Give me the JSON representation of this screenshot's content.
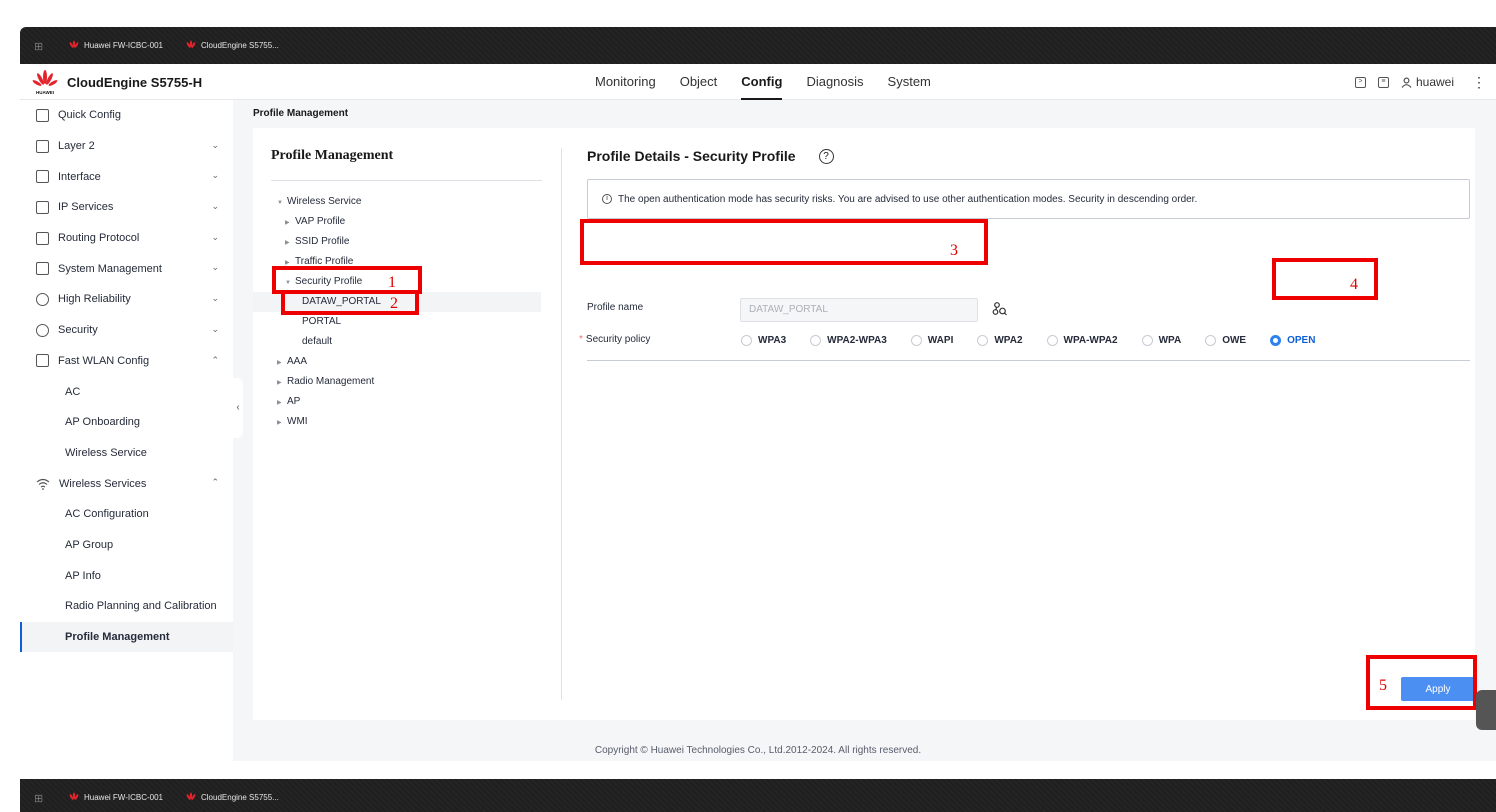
{
  "browser": {
    "tabs": [
      "Huawei FW-ICBC-001",
      "CloudEngine S5755..."
    ]
  },
  "header": {
    "logo_text": "HUAWEI",
    "product": "CloudEngine S5755-H",
    "nav": [
      "Monitoring",
      "Object",
      "Config",
      "Diagnosis",
      "System"
    ],
    "active_nav": "Config",
    "user": "huawei",
    "more": "⋮"
  },
  "sidebar": {
    "items": [
      {
        "label": "Quick Config",
        "icon": "quick-config-icon"
      },
      {
        "label": "Layer 2",
        "icon": "layer2-icon",
        "chevron": "⌄"
      },
      {
        "label": "Interface",
        "icon": "interface-icon",
        "chevron": "⌄"
      },
      {
        "label": "IP Services",
        "icon": "ip-services-icon",
        "chevron": "⌄"
      },
      {
        "label": "Routing Protocol",
        "icon": "routing-icon",
        "chevron": "⌄"
      },
      {
        "label": "System Management",
        "icon": "system-management-icon",
        "chevron": "⌄"
      },
      {
        "label": "High Reliability",
        "icon": "reliability-icon",
        "chevron": "⌄"
      },
      {
        "label": "Security",
        "icon": "security-icon",
        "chevron": "⌄"
      },
      {
        "label": "Fast WLAN Config",
        "icon": "wlan-config-icon",
        "chevron": "⌃"
      },
      {
        "label": "AC"
      },
      {
        "label": "AP Onboarding"
      },
      {
        "label": "Wireless Service"
      },
      {
        "label": "Wireless Services",
        "icon": "wifi-icon",
        "chevron": "⌃"
      },
      {
        "label": "AC Configuration"
      },
      {
        "label": "AP Group"
      },
      {
        "label": "AP Info"
      },
      {
        "label": "Radio Planning and Calibration"
      },
      {
        "label": "Profile Management"
      }
    ],
    "collapse_glyph": "‹"
  },
  "breadcrumb": "Profile Management",
  "tree": {
    "title": "Profile Management",
    "nodes": [
      {
        "label": "Wireless Service",
        "tri": "▼"
      },
      {
        "label": "VAP Profile",
        "tri": "▶"
      },
      {
        "label": "SSID Profile",
        "tri": "▶"
      },
      {
        "label": "Traffic Profile",
        "tri": "▶"
      },
      {
        "label": "Security Profile",
        "tri": "▼"
      },
      {
        "label": "DATAW_PORTAL"
      },
      {
        "label": "PORTAL"
      },
      {
        "label": "default"
      },
      {
        "label": "AAA",
        "tri": "▶"
      },
      {
        "label": "Radio Management",
        "tri": "▶"
      },
      {
        "label": "AP",
        "tri": "▶"
      },
      {
        "label": "WMI",
        "tri": "▶"
      }
    ]
  },
  "details": {
    "title": "Profile Details - Security Profile",
    "help": "?",
    "alert_icon": "i",
    "alert": "The open authentication mode has security risks. You are advised to use other authentication modes. Security in descending order.",
    "profile_name_label": "Profile name",
    "profile_name_value": "DATAW_PORTAL",
    "required_mark": "*",
    "security_policy_label": "Security policy",
    "policies": [
      "WPA3",
      "WPA2-WPA3",
      "WAPI",
      "WPA2",
      "WPA-WPA2",
      "WPA",
      "OWE",
      "OPEN"
    ],
    "selected_policy": "OPEN",
    "apply": "Apply"
  },
  "footer": "Copyright © Huawei Technologies Co., Ltd.2012-2024. All rights reserved.",
  "annotations": [
    "1",
    "2",
    "3",
    "4",
    "5"
  ],
  "colors": {
    "annotation": "#ee0000",
    "primary": "#4c8ff3",
    "selected_radio": "#2d82f0"
  }
}
